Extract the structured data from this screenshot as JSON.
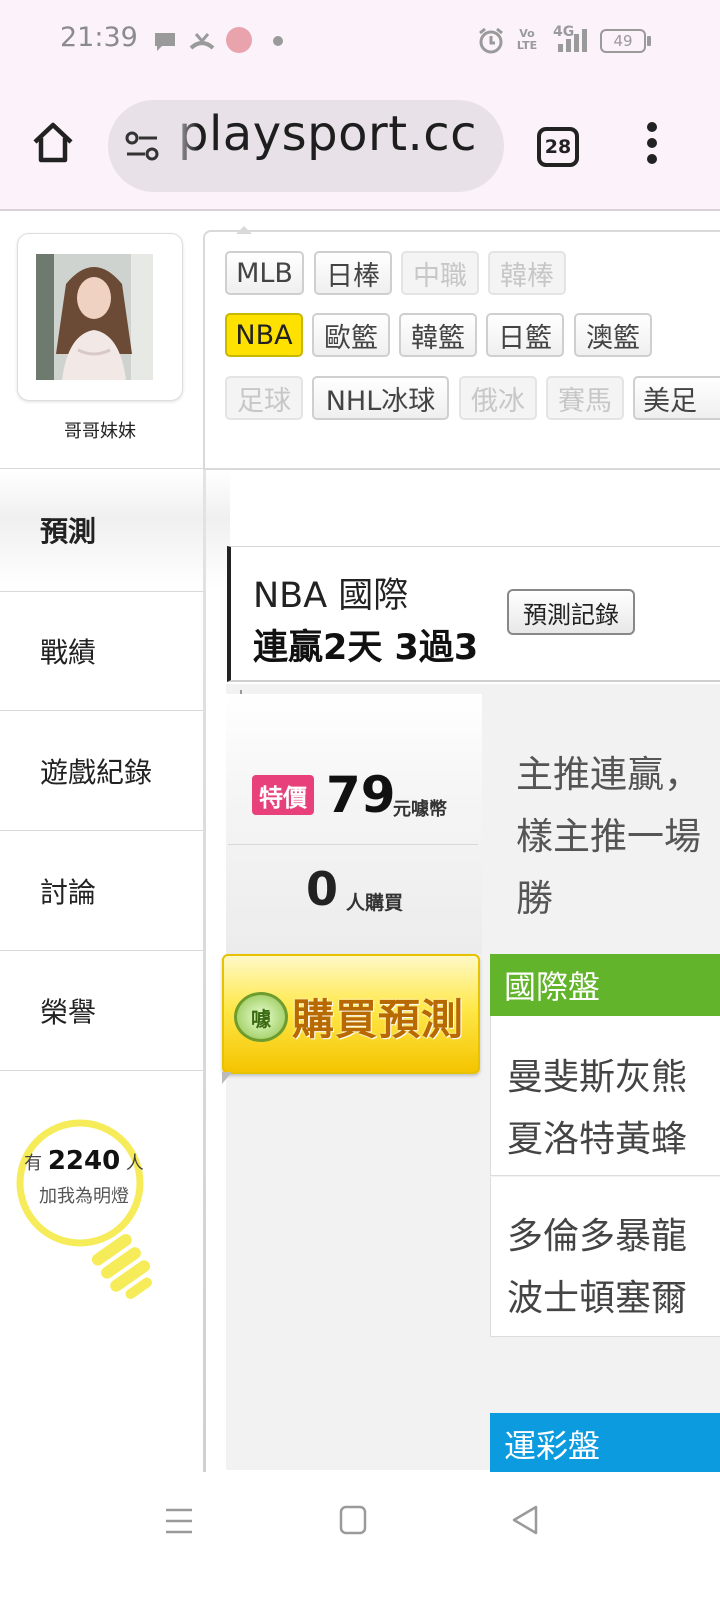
{
  "status_bar": {
    "time": "21:39",
    "icons": [
      "chat-bubble-icon",
      "missed-call-icon",
      "app-avatar-icon",
      "dot-icon",
      "alarm-icon",
      "volte-icon",
      "signal-4g-icon"
    ],
    "volte_label": "Vo LTE",
    "network_label": "4G",
    "battery": "49"
  },
  "browser": {
    "url": "playsport.cc",
    "tab_count": "28"
  },
  "profile": {
    "name": "哥哥妹妹"
  },
  "sidebar": {
    "items": [
      {
        "label": "預測",
        "active": true
      },
      {
        "label": "戰績",
        "active": false
      },
      {
        "label": "遊戲紀錄",
        "active": false
      },
      {
        "label": "討論",
        "active": false
      },
      {
        "label": "榮譽",
        "active": false
      }
    ]
  },
  "fans": {
    "prefix": "有",
    "count": "2240",
    "suffix": "人",
    "caption": "加我為明燈"
  },
  "sport_tabs": {
    "row1": [
      "MLB",
      "日棒",
      "中職",
      "韓棒"
    ],
    "row2": [
      "NBA",
      "歐籃",
      "韓籃",
      "日籃",
      "澳籃"
    ],
    "row3": [
      "足球",
      "NHL冰球",
      "俄冰",
      "賽馬",
      "美足"
    ],
    "selected": "NBA",
    "disabled": [
      "中職",
      "韓棒",
      "足球",
      "俄冰",
      "賽馬"
    ]
  },
  "prediction": {
    "title": "NBA 國際",
    "streak": "連贏2天 3過3",
    "history_button": "預測記錄",
    "price_badge": "特價",
    "price": "79",
    "price_unit": "元噱幣",
    "buyers": "0",
    "buyers_unit": "人購買",
    "buy_button": "購買預測",
    "buy_coin_char": "噱",
    "analysis_lines": [
      "主推連贏，",
      "樣主推一場",
      "勝"
    ]
  },
  "markets": {
    "international": {
      "label": "國際盤",
      "matches": [
        [
          "曼斐斯灰熊",
          "夏洛特黃蜂"
        ],
        [
          "多倫多暴龍",
          "波士頓塞爾"
        ]
      ]
    },
    "lottery": {
      "label": "運彩盤"
    }
  },
  "navbar": {
    "icons": [
      "menu-icon",
      "home-square-icon",
      "back-triangle-icon"
    ]
  }
}
